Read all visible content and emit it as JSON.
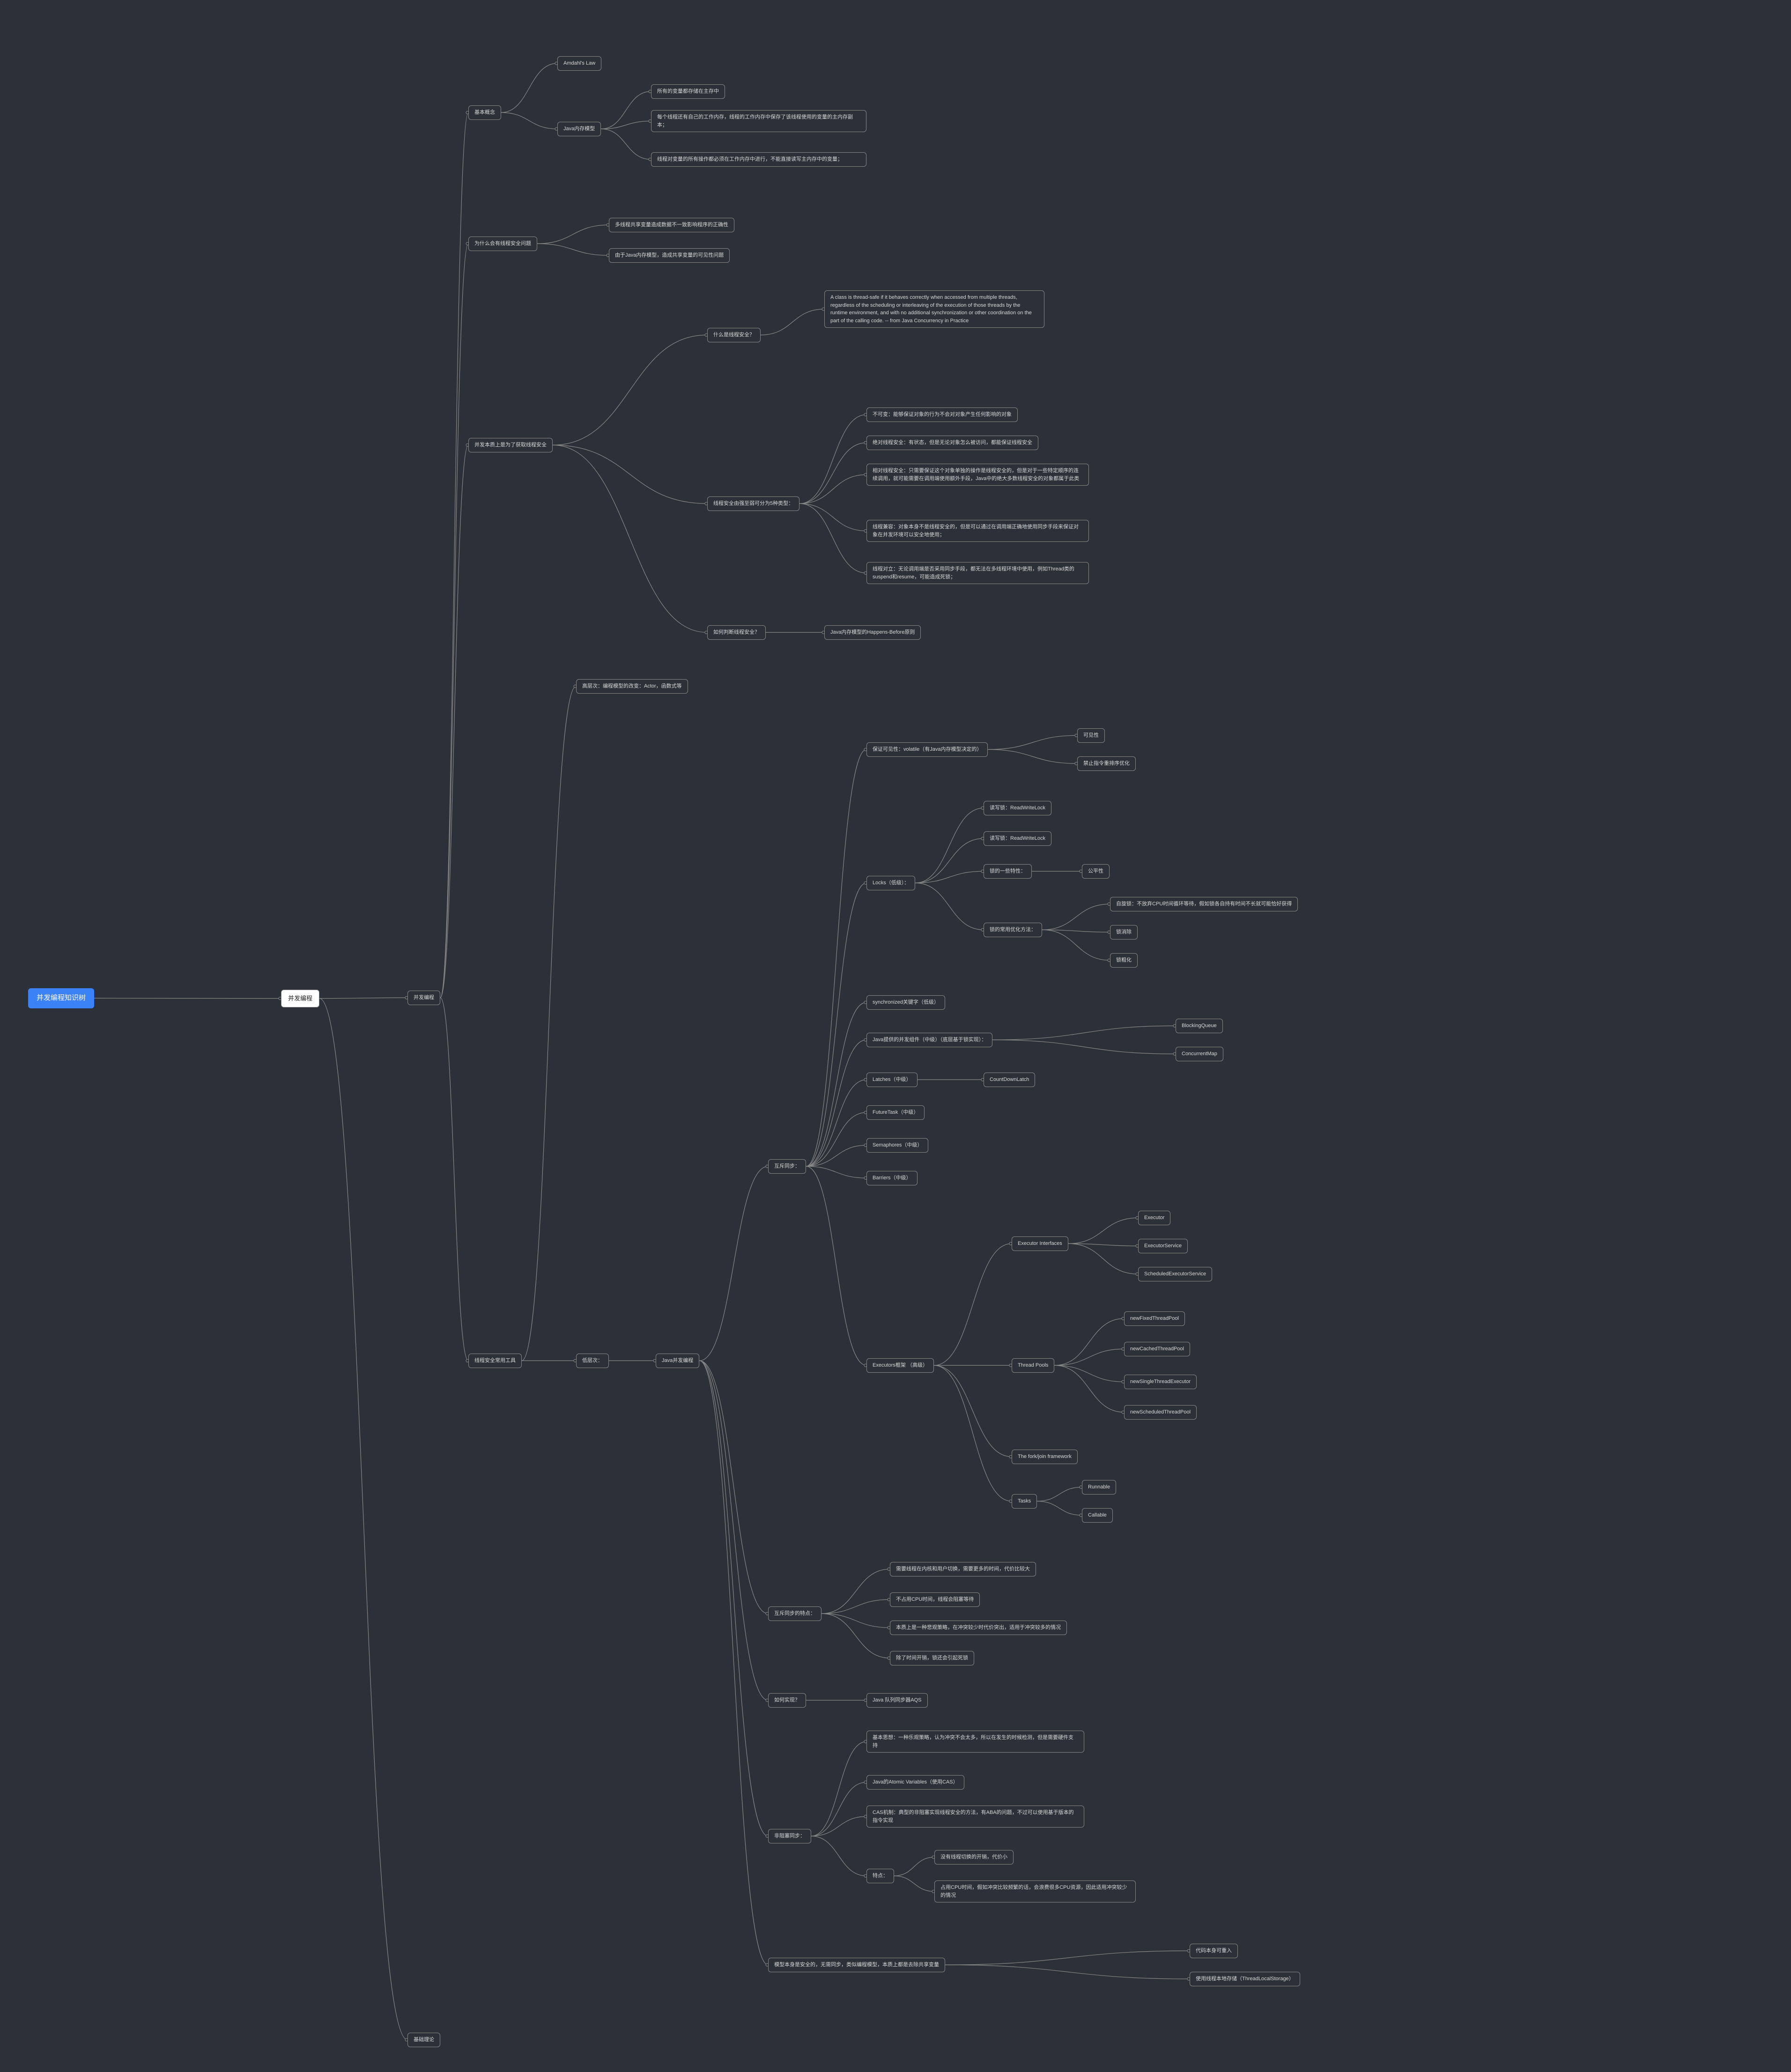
{
  "root": "并发编程知识树",
  "n1": "并发编程",
  "n1_1": "基本概念",
  "n1_1_1": "Amdahl's Law",
  "n1_1_2": "Java内存模型",
  "n1_1_2_1": "所有的变量都存储在主存中",
  "n1_1_2_2": "每个线程还有自己的工作内存，线程的工作内存中保存了该线程使用的变量的主内存副本；",
  "n1_1_2_3": "线程对变量的所有操作都必须在工作内存中进行，不能直接读写主内存中的变量；",
  "n1_2": "为什么会有线程安全问题",
  "n1_2_1": "多线程共享变量造成数据不一致影响程序的正确性",
  "n1_2_2": "由于Java内存模型，造成共享变量的可见性问题",
  "n1_3": "并发本质上是为了获取线程安全",
  "n1_3_1": "什么是线程安全？",
  "n1_3_1_1": "A class is thread-safe if it behaves correctly when accessed from multiple threads, regardless of the scheduling or interleaving of the execution of those threads by the runtime environment, and with no additional synchronization or other coordination on the part of the calling code. -- from Java Concurrency in Practice",
  "n1_3_2": "线程安全由强至弱可分为5种类型：",
  "n1_3_2_1": "不可变：能够保证对象的行为不会对对象产生任何影响的对象",
  "n1_3_2_2": "绝对线程安全：有状态，但是无论对象怎么被访问，都能保证线程安全",
  "n1_3_2_3": "相对线程安全：只需要保证这个对象单独的操作是线程安全的，但是对于一些特定顺序的连续调用，就可能需要在调用端使用额外手段，Java中的绝大多数线程安全的对象都属于此类",
  "n1_3_2_4": "线程兼容：对象本身不是线程安全的，但是可以通过在调用端正确地使用同步手段来保证对象在并发环境可以安全地使用；",
  "n1_3_2_5": "线程对立：无论调用端是否采用同步手段，都无法在多线程环境中使用，例如Thread类的suspend和resume，可能造成死锁；",
  "n1_3_3": "如何判断线程安全？",
  "n1_3_3_1": "Java内存模型的Happens-Before原则",
  "n1_4": "线程安全常用工具",
  "n1_4_1": "高层次：编程模型的改变：Actor，函数式等",
  "n1_4_2": "低层次：",
  "n1_4_2_1": "Java并发编程",
  "mu": "互斥同步：",
  "mu_1": "保证可见性：volatile（有Java内存模型决定的）",
  "mu_1_1": "可见性",
  "mu_1_2": "禁止指令重排序优化",
  "mu_2": "Locks（低级）：",
  "mu_2_1": "读写锁：ReadWriteLock",
  "mu_2_2": "读写锁：ReadWriteLock",
  "mu_2_3": "锁的一些特性：",
  "mu_2_3_1": "公平性",
  "mu_2_4": "锁的常用优化方法：",
  "mu_2_4_1": "自旋锁：不放弃CPU时间循环等待，假如锁各自持有时间不长就可能恰好获得",
  "mu_2_4_2": "锁消除",
  "mu_2_4_3": "锁粗化",
  "mu_3": "synchronized关键字（低级）",
  "mu_4": "Java提供的并发组件（中级）（底层基于锁实现）：",
  "mu_4_1": "BlockingQueue",
  "mu_4_2": "ConcurrentMap",
  "mu_5": "Latches（中级）",
  "mu_5_1": "CountDownLatch",
  "mu_6": "FutureTask（中级）",
  "mu_7": "Semaphores（中级）",
  "mu_8": "Barriers（中级）",
  "mu_9": "Executors框架 （高级）",
  "mu_9_1": "Executor Interfaces",
  "mu_9_1_1": "Executor",
  "mu_9_1_2": "ExecutorService",
  "mu_9_1_3": "ScheduledExecutorService",
  "mu_9_2": "Thread Pools",
  "mu_9_2_1": "newFixedThreadPool",
  "mu_9_2_2": "newCachedThreadPool",
  "mu_9_2_3": "newSingleThreadExecutor",
  "mu_9_2_4": "newScheduledThreadPool",
  "mu_9_3": "The fork/join framework",
  "mu_9_4": "Tasks",
  "mu_9_4_1": "Runnable",
  "mu_9_4_2": "Callable",
  "mu_x": "互斥同步的特点：",
  "mu_x_1": "需要线程在内核和用户切换，需要更多的时间，代价比较大",
  "mu_x_2": "不占用CPU时间，线程会阻塞等待",
  "mu_x_3": "本质上是一种悲观策略，在冲突较少时代价突出，适用于冲突较多的情况",
  "mu_x_4": "除了时间开销，锁还会引起死锁",
  "how": "如何实现？",
  "how_1": "Java 队列同步器AQS",
  "nb": "非阻塞同步：",
  "nb_1": "基本思想：一种乐观策略，认为冲突不会太多，所以在发生的时候检测，但是需要硬件支持",
  "nb_2": "Java的Atomic Variables（使用CAS）",
  "nb_3": "CAS机制：典型的非阻塞实现线程安全的方法，有ABA的问题，不过可以使用基于版本的指令实现",
  "nb_4": "特点：",
  "nb_4_1": "没有线程切换的开销，代价小",
  "nb_4_2": "占用CPU时间，假如冲突比较频繁的话，会浪费很多CPU资源，因此适用冲突较少的情况",
  "mod": "模型本身是安全的，无需同步，类似编程模型，本质上都是去除共享变量",
  "mod_1": "代码本身可重入",
  "mod_2": "使用线程本地存储（ThreadLocalStorage）",
  "n1_5": "基础理论"
}
